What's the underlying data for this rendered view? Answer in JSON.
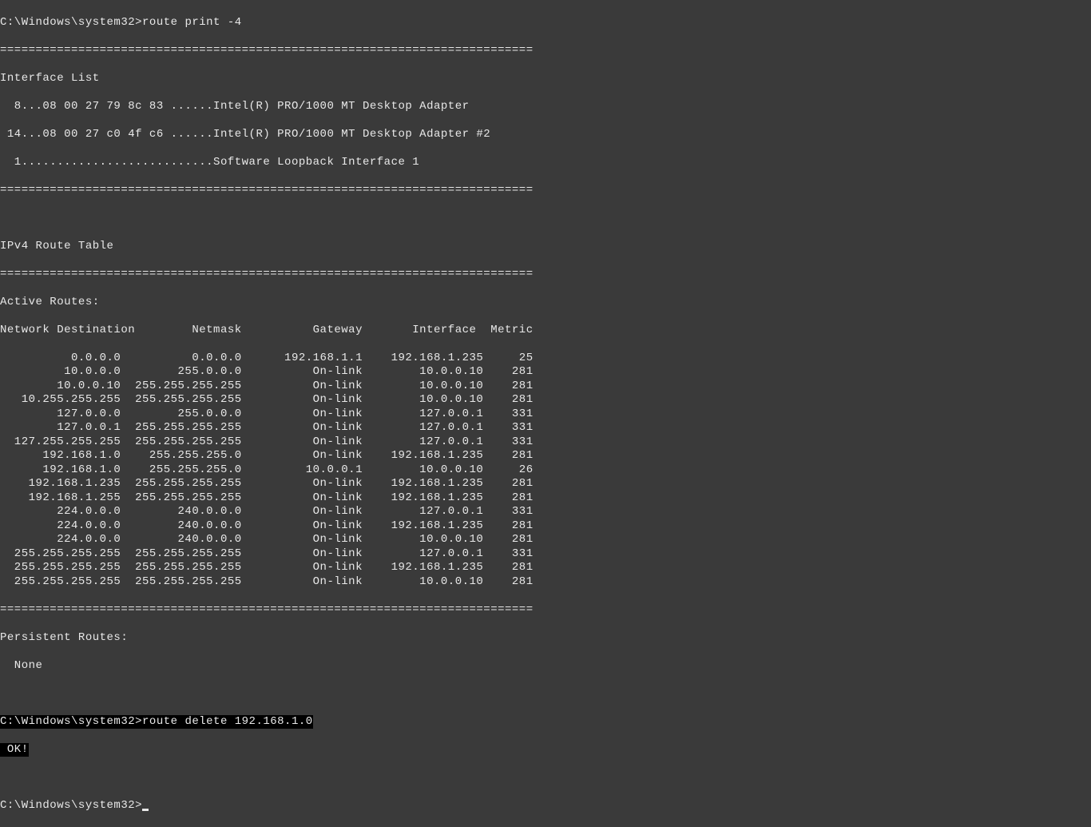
{
  "prompt": "C:\\Windows\\system32>",
  "command1": "route print -4",
  "separator": "===========================================================================",
  "interface_list_header": "Interface List",
  "interfaces": [
    "  8...08 00 27 79 8c 83 ......Intel(R) PRO/1000 MT Desktop Adapter",
    " 14...08 00 27 c0 4f c6 ......Intel(R) PRO/1000 MT Desktop Adapter #2",
    "  1...........................Software Loopback Interface 1"
  ],
  "route_table_header": "IPv4 Route Table",
  "active_routes_header": "Active Routes:",
  "columns_header": "Network Destination        Netmask          Gateway       Interface  Metric",
  "routes": [
    {
      "dest": "0.0.0.0",
      "mask": "0.0.0.0",
      "gateway": "192.168.1.1",
      "iface": "192.168.1.235",
      "metric": "25"
    },
    {
      "dest": "10.0.0.0",
      "mask": "255.0.0.0",
      "gateway": "On-link",
      "iface": "10.0.0.10",
      "metric": "281"
    },
    {
      "dest": "10.0.0.10",
      "mask": "255.255.255.255",
      "gateway": "On-link",
      "iface": "10.0.0.10",
      "metric": "281"
    },
    {
      "dest": "10.255.255.255",
      "mask": "255.255.255.255",
      "gateway": "On-link",
      "iface": "10.0.0.10",
      "metric": "281"
    },
    {
      "dest": "127.0.0.0",
      "mask": "255.0.0.0",
      "gateway": "On-link",
      "iface": "127.0.0.1",
      "metric": "331"
    },
    {
      "dest": "127.0.0.1",
      "mask": "255.255.255.255",
      "gateway": "On-link",
      "iface": "127.0.0.1",
      "metric": "331"
    },
    {
      "dest": "127.255.255.255",
      "mask": "255.255.255.255",
      "gateway": "On-link",
      "iface": "127.0.0.1",
      "metric": "331"
    },
    {
      "dest": "192.168.1.0",
      "mask": "255.255.255.0",
      "gateway": "On-link",
      "iface": "192.168.1.235",
      "metric": "281"
    },
    {
      "dest": "192.168.1.0",
      "mask": "255.255.255.0",
      "gateway": "10.0.0.1",
      "iface": "10.0.0.10",
      "metric": "26"
    },
    {
      "dest": "192.168.1.235",
      "mask": "255.255.255.255",
      "gateway": "On-link",
      "iface": "192.168.1.235",
      "metric": "281"
    },
    {
      "dest": "192.168.1.255",
      "mask": "255.255.255.255",
      "gateway": "On-link",
      "iface": "192.168.1.235",
      "metric": "281"
    },
    {
      "dest": "224.0.0.0",
      "mask": "240.0.0.0",
      "gateway": "On-link",
      "iface": "127.0.0.1",
      "metric": "331"
    },
    {
      "dest": "224.0.0.0",
      "mask": "240.0.0.0",
      "gateway": "On-link",
      "iface": "192.168.1.235",
      "metric": "281"
    },
    {
      "dest": "224.0.0.0",
      "mask": "240.0.0.0",
      "gateway": "On-link",
      "iface": "10.0.0.10",
      "metric": "281"
    },
    {
      "dest": "255.255.255.255",
      "mask": "255.255.255.255",
      "gateway": "On-link",
      "iface": "127.0.0.1",
      "metric": "331"
    },
    {
      "dest": "255.255.255.255",
      "mask": "255.255.255.255",
      "gateway": "On-link",
      "iface": "192.168.1.235",
      "metric": "281"
    },
    {
      "dest": "255.255.255.255",
      "mask": "255.255.255.255",
      "gateway": "On-link",
      "iface": "10.0.0.10",
      "metric": "281"
    }
  ],
  "persistent_routes_header": "Persistent Routes:",
  "persistent_routes_value": "  None",
  "command2": "route delete 192.168.1.0",
  "response2": " OK!"
}
